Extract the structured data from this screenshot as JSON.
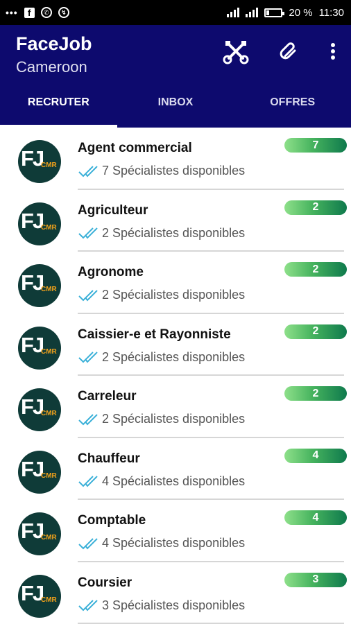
{
  "status_bar": {
    "left_icons": [
      "more-dots-icon",
      "facebook-icon",
      "whatsapp-icon",
      "data-saver-icon"
    ],
    "battery": "20 %",
    "time": "11:30"
  },
  "app": {
    "title": "FaceJob",
    "subtitle": "Cameroon",
    "actions": [
      "tools-icon",
      "attachment-icon",
      "more-vertical-icon"
    ],
    "accent_color": "#0d0a6e"
  },
  "tabs": [
    {
      "label": "RECRUTER",
      "active": true
    },
    {
      "label": "INBOX",
      "active": false
    },
    {
      "label": "OFFRES",
      "active": false
    }
  ],
  "avatar": {
    "initials": "FJ",
    "tag": "CMR"
  },
  "jobs": [
    {
      "title": "Agent commercial",
      "subtitle": "7 Spécialistes disponibles",
      "count": "7"
    },
    {
      "title": "Agriculteur",
      "subtitle": "2 Spécialistes disponibles",
      "count": "2"
    },
    {
      "title": "Agronome",
      "subtitle": "2 Spécialistes disponibles",
      "count": "2"
    },
    {
      "title": "Caissier-e et Rayonniste",
      "subtitle": "2 Spécialistes disponibles",
      "count": "2"
    },
    {
      "title": "Carreleur",
      "subtitle": "2 Spécialistes disponibles",
      "count": "2"
    },
    {
      "title": "Chauffeur",
      "subtitle": "4 Spécialistes disponibles",
      "count": "4"
    },
    {
      "title": "Comptable",
      "subtitle": "4 Spécialistes disponibles",
      "count": "4"
    },
    {
      "title": "Coursier",
      "subtitle": "3 Spécialistes disponibles",
      "count": "3"
    }
  ]
}
